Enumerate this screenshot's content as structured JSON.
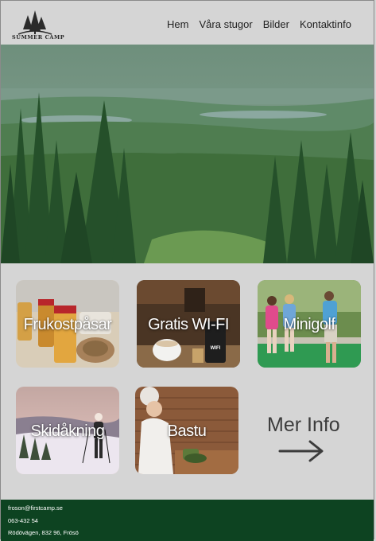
{
  "brand": {
    "logo_text": "SUMMER CAMP"
  },
  "nav": {
    "items": [
      {
        "label": "Hem"
      },
      {
        "label": "Våra stugor"
      },
      {
        "label": "Bilder"
      },
      {
        "label": "Kontaktinfo"
      }
    ]
  },
  "activities": [
    {
      "label": "Frukostpåsar"
    },
    {
      "label": "Gratis WI-FI"
    },
    {
      "label": "Minigolf"
    },
    {
      "label": "Skidåkning"
    },
    {
      "label": "Bastu"
    }
  ],
  "wifi_sign": "WIFI",
  "more": {
    "label": "Mer Info",
    "icon": "arrow-right-icon"
  },
  "footer": {
    "email": "froson@firstcamp.se",
    "phone": "063-432 54",
    "address": "Rödövägen, 832 96, Frösö"
  },
  "colors": {
    "footer_bg": "#0d4321",
    "page_bg": "#d5d5d5",
    "hero_tint": "#2f6b37"
  }
}
